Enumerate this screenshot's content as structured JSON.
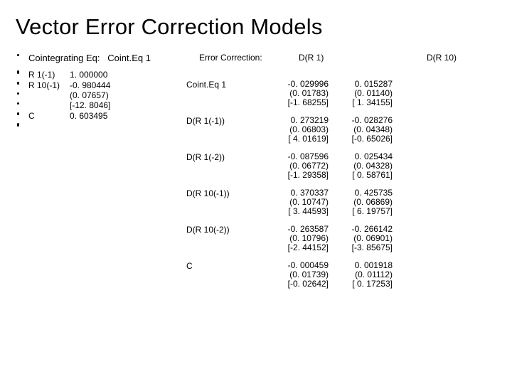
{
  "title": "Vector Error Correction Models",
  "left": {
    "hdr_a": "Cointegrating Eq:",
    "hdr_b": "Coint.Eq 1",
    "r1_a": "R 1(-1)",
    "r1_b": "1. 000000",
    "r10_a": "R 10(-1)",
    "r10_b": "-0. 980444",
    "r10_se": "(0. 07657)",
    "r10_t": "[-12. 8046]",
    "c_a": "C",
    "c_b": "0. 603495"
  },
  "right": {
    "hdr_a": "Error Correction:",
    "hdr_b": "D(R 1)",
    "hdr_c": "D(R 10)",
    "rows": {
      "r0": {
        "n": "Coint.Eq 1",
        "a1": "-0. 029996",
        "a2": "0. 015287",
        "b1": "(0. 01783)",
        "b2": "(0. 01140)",
        "c1": "[-1. 68255]",
        "c2": "[ 1. 34155]"
      },
      "r1": {
        "n": "D(R 1(-1))",
        "a1": "0. 273219",
        "a2": "-0. 028276",
        "b1": "(0. 06803)",
        "b2": "(0. 04348)",
        "c1": "[ 4. 01619]",
        "c2": "[-0. 65026]"
      },
      "r2": {
        "n": "D(R 1(-2))",
        "a1": "-0. 087596",
        "a2": "0. 025434",
        "b1": "(0. 06772)",
        "b2": "(0. 04328)",
        "c1": "[-1. 29358]",
        "c2": "[ 0. 58761]"
      },
      "r3": {
        "n": "D(R 10(-1))",
        "a1": "0. 370337",
        "a2": "0. 425735",
        "b1": "(0. 10747)",
        "b2": "(0. 06869)",
        "c1": "[ 3. 44593]",
        "c2": "[ 6. 19757]"
      },
      "r4": {
        "n": "D(R 10(-2))",
        "a1": "-0. 263587",
        "a2": "-0. 266142",
        "b1": "(0. 10796)",
        "b2": "(0. 06901)",
        "c1": "[-2. 44152]",
        "c2": "[-3. 85675]"
      },
      "r5": {
        "n": "C",
        "a1": "-0. 000459",
        "a2": "0. 001918",
        "b1": "(0. 01739)",
        "b2": "(0. 01112)",
        "c1": "[-0. 02642]",
        "c2": "[ 0. 17253]"
      }
    }
  }
}
